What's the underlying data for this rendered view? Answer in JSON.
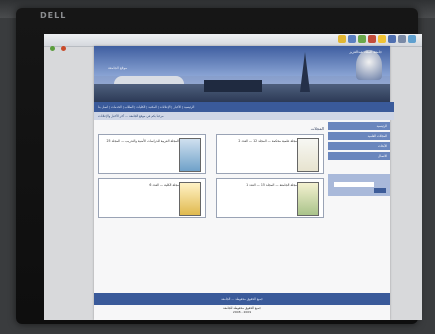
{
  "device": {
    "brand": "DELL"
  },
  "banner": {
    "university_name": "جامعة الملك عبدالعزيز",
    "subtitle": "موقع الجامعة"
  },
  "nav": {
    "items_text": "الرئيسية | الأخبار | الإعلانات | المكتبة | الكليات | الطلاب | الخدمات | اتصل بنا"
  },
  "ticker": {
    "text": "مرحبا بكم في موقع الجامعة — آخر الأخبار والإعلانات"
  },
  "main": {
    "section_title": "المجلات",
    "cards": [
      {
        "text": "مجلة علمية محكمة — المجلد 12 — العدد 2"
      },
      {
        "text": "المجلة العربية للدراسات الأمنية والتدريب — المجلد 25"
      },
      {
        "text": "مجلة الجامعة — المجلد 15 — العدد 1"
      },
      {
        "text": "مجلة الكلية — العدد 6"
      }
    ]
  },
  "sidebar": {
    "links": [
      "الرئيسية",
      "المجلات العلمية",
      "الأبحاث",
      "الاتصال"
    ]
  },
  "footer": {
    "text": "جميع الحقوق محفوظة — الجامعة"
  },
  "copyright": {
    "line1": "جميع الحقوق محفوظة للجامعة",
    "line2": "2008 - 2009"
  }
}
